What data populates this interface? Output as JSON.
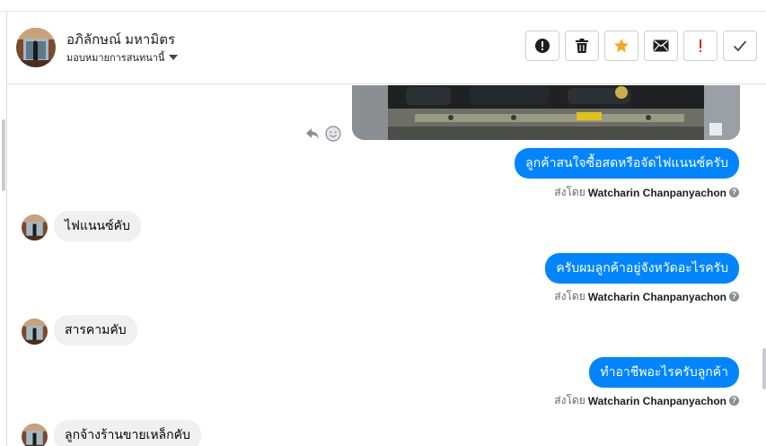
{
  "header": {
    "contact_name": "อภิลักษณ์ มหามิตร",
    "assign_label": "มอบหมายการสนทนานี้",
    "actions": [
      {
        "icon": "alert-circle-icon",
        "name": "mark-spam-button"
      },
      {
        "icon": "trash-icon",
        "name": "delete-button"
      },
      {
        "icon": "star-icon",
        "name": "follow-up-button"
      },
      {
        "icon": "envelope-icon",
        "name": "mark-unread-button"
      },
      {
        "icon": "exclamation-icon",
        "name": "mark-important-button"
      },
      {
        "icon": "check-icon",
        "name": "mark-done-button"
      }
    ]
  },
  "colors": {
    "outgoing_bubble": "#0084ff",
    "incoming_bubble": "#f0f0f0",
    "star": "#f5a623",
    "exclamation": "#e02424"
  },
  "messages": [
    {
      "direction": "out",
      "text": "ลูกค้าสนใจซื้อสดหรือจัดไฟแนนซ์ครับ",
      "sent_by_prefix": "ส่งโดย",
      "sender": "Watcharin Chanpanyachon"
    },
    {
      "direction": "in",
      "text": "ไฟแนนซ์คับ"
    },
    {
      "direction": "out",
      "text": "ครับผมลูกค้าอยู่จังหวัดอะไรครับ",
      "sent_by_prefix": "ส่งโดย",
      "sender": "Watcharin Chanpanyachon"
    },
    {
      "direction": "in",
      "text": "สารคามคับ"
    },
    {
      "direction": "out",
      "text": "ทำอาชีพอะไรครับลูกค้า",
      "sent_by_prefix": "ส่งโดย",
      "sender": "Watcharin Chanpanyachon"
    },
    {
      "direction": "in",
      "text": "ลูกจ้างร้านขายเหล็กคับ"
    }
  ]
}
